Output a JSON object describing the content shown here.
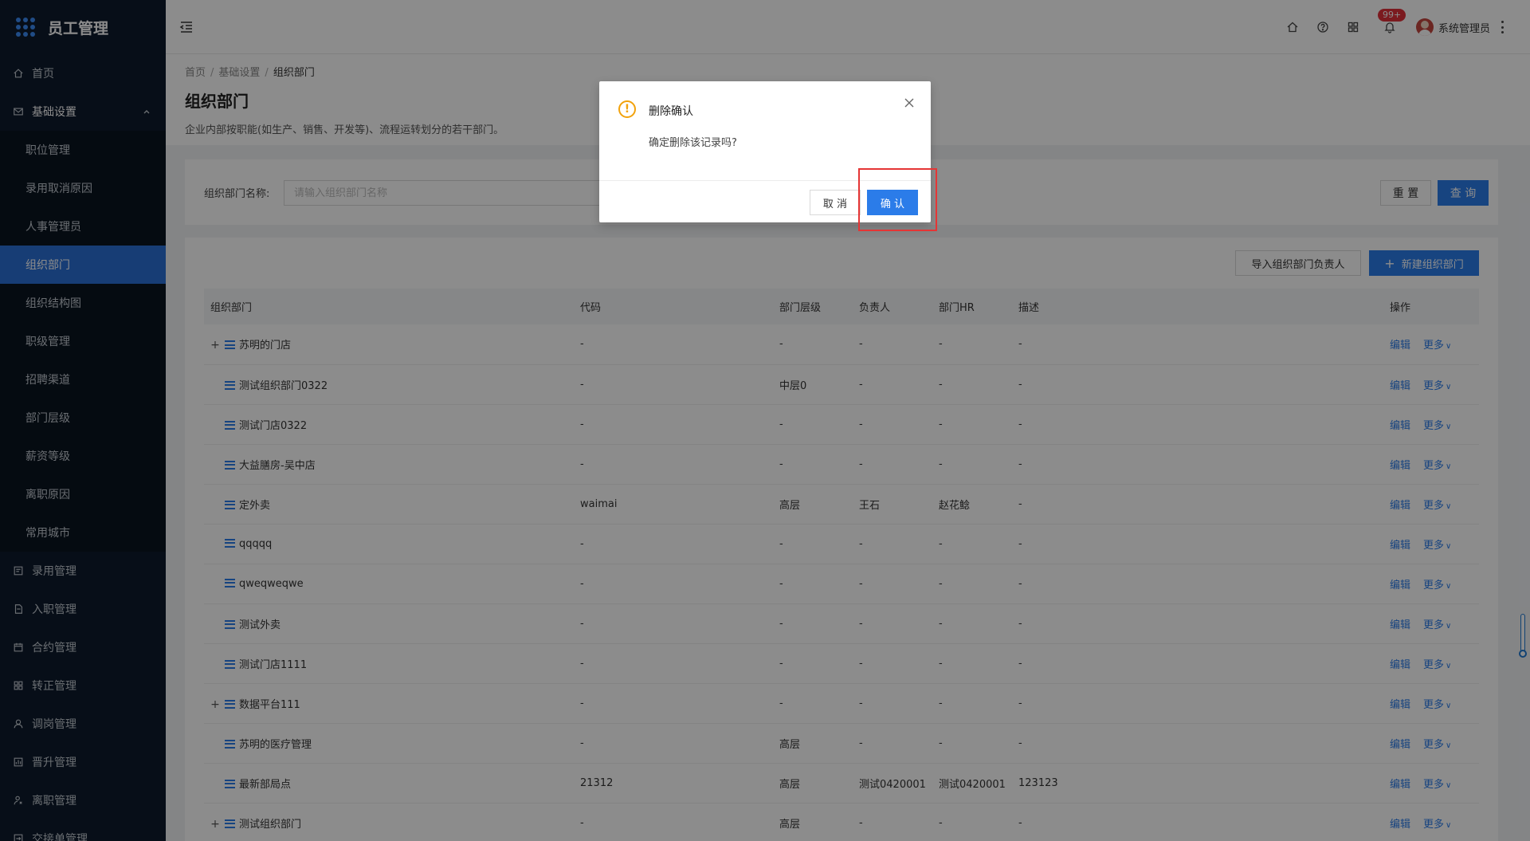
{
  "app": {
    "title": "员工管理"
  },
  "sidebar": {
    "items": [
      {
        "label": "首页",
        "icon": "home-icon"
      },
      {
        "label": "基础设置",
        "icon": "mail-icon",
        "open": true,
        "children": [
          "职位管理",
          "录用取消原因",
          "人事管理员",
          "组织部门",
          "组织结构图",
          "职级管理",
          "招聘渠道",
          "部门层级",
          "薪资等级",
          "离职原因",
          "常用城市"
        ],
        "active_child": "组织部门"
      },
      {
        "label": "录用管理",
        "icon": "form-icon"
      },
      {
        "label": "入职管理",
        "icon": "doc-icon"
      },
      {
        "label": "合约管理",
        "icon": "calendar-icon"
      },
      {
        "label": "转正管理",
        "icon": "grid-icon"
      },
      {
        "label": "调岗管理",
        "icon": "user-icon"
      },
      {
        "label": "晋升管理",
        "icon": "chart-icon"
      },
      {
        "label": "离职管理",
        "icon": "exit-icon"
      },
      {
        "label": "交接单管理",
        "icon": "handover-icon"
      }
    ]
  },
  "header": {
    "notification_badge": "99+",
    "user_name": "系统管理员"
  },
  "page": {
    "breadcrumb": [
      "首页",
      "基础设置",
      "组织部门"
    ],
    "title": "组织部门",
    "description": "企业内部按职能(如生产、销售、开发等)、流程运转划分的若干部门。"
  },
  "search": {
    "label": "组织部门名称:",
    "placeholder": "请输入组织部门名称",
    "value": "",
    "reset_label": "重 置",
    "query_label": "查 询"
  },
  "toolbar": {
    "import_label": "导入组织部门负责人",
    "new_label": "新建组织部门"
  },
  "table": {
    "columns": [
      "组织部门",
      "代码",
      "部门层级",
      "负责人",
      "部门HR",
      "描述",
      "操作"
    ],
    "edit_label": "编辑",
    "more_label": "更多",
    "rows": [
      {
        "expandable": true,
        "name": "苏明的门店",
        "code": "-",
        "level": "-",
        "owner": "-",
        "hr": "-",
        "desc": "-"
      },
      {
        "expandable": false,
        "name": "测试组织部门0322",
        "code": "-",
        "level": "中层0",
        "owner": "-",
        "hr": "-",
        "desc": "-"
      },
      {
        "expandable": false,
        "name": "测试门店0322",
        "code": "-",
        "level": "-",
        "owner": "-",
        "hr": "-",
        "desc": "-"
      },
      {
        "expandable": false,
        "name": "大益膳房-吴中店",
        "code": "-",
        "level": "-",
        "owner": "-",
        "hr": "-",
        "desc": "-"
      },
      {
        "expandable": false,
        "name": "定外卖",
        "code": "waimai",
        "level": "高层",
        "owner": "王石",
        "hr": "赵花鲶",
        "desc": "-"
      },
      {
        "expandable": false,
        "name": "qqqqq",
        "code": "-",
        "level": "-",
        "owner": "-",
        "hr": "-",
        "desc": "-"
      },
      {
        "expandable": false,
        "name": "qweqweqwe",
        "code": "-",
        "level": "-",
        "owner": "-",
        "hr": "-",
        "desc": "-"
      },
      {
        "expandable": false,
        "name": "测试外卖",
        "code": "-",
        "level": "-",
        "owner": "-",
        "hr": "-",
        "desc": "-"
      },
      {
        "expandable": false,
        "name": "测试门店1111",
        "code": "-",
        "level": "-",
        "owner": "-",
        "hr": "-",
        "desc": "-"
      },
      {
        "expandable": true,
        "name": "数据平台111",
        "code": "-",
        "level": "-",
        "owner": "-",
        "hr": "-",
        "desc": "-"
      },
      {
        "expandable": false,
        "name": "苏明的医疗管理",
        "code": "-",
        "level": "高层",
        "owner": "-",
        "hr": "-",
        "desc": "-"
      },
      {
        "expandable": false,
        "name": "最新部局点",
        "code": "21312",
        "level": "高层",
        "owner": "测试0420001",
        "hr": "测试0420001",
        "desc": "123123"
      },
      {
        "expandable": true,
        "name": "测试组织部门",
        "code": "-",
        "level": "高层",
        "owner": "-",
        "hr": "-",
        "desc": "-"
      }
    ]
  },
  "dialog": {
    "title": "删除确认",
    "message": "确定删除该记录吗?",
    "cancel_label": "取 消",
    "confirm_label": "确 认"
  },
  "colors": {
    "sidebar_bg": "#0e1b2c",
    "primary": "#2b7ce9",
    "warning": "#f2a20c",
    "highlight": "#e53535"
  }
}
